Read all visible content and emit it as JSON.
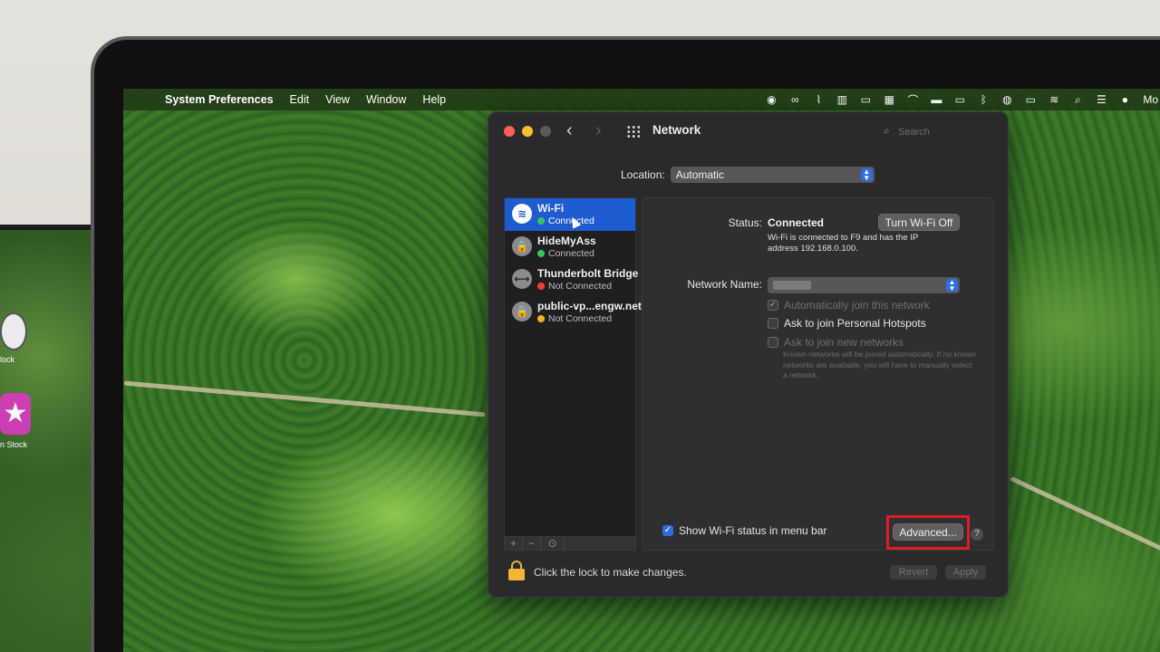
{
  "menubar": {
    "app_name": "System Preferences",
    "menus": [
      "Edit",
      "View",
      "Window",
      "Help"
    ],
    "clock_partial": "Mo"
  },
  "desktop": {
    "side_labels": [
      "lock",
      "n Stock"
    ]
  },
  "window": {
    "title": "Network",
    "search_placeholder": "Search",
    "location_label": "Location:",
    "location_value": "Automatic",
    "services": [
      {
        "name": "Wi-Fi",
        "status": "Connected",
        "dot": "#34c759",
        "icon": "wifi-icon"
      },
      {
        "name": "HideMyAss",
        "status": "Connected",
        "dot": "#34c759",
        "icon": "lock-icon"
      },
      {
        "name": "Thunderbolt Bridge",
        "status": "Not Connected",
        "dot": "#ff3b30",
        "icon": "bridge-icon"
      },
      {
        "name": "public-vp...engw.net",
        "status": "Not Connected",
        "dot": "#ffb020",
        "icon": "lock-icon"
      }
    ],
    "detail": {
      "status_label": "Status:",
      "status_value": "Connected",
      "toggle_button": "Turn Wi-Fi Off",
      "status_description": "Wi-Fi is connected to F9  and has the IP address 192.168.0.100.",
      "network_name_label": "Network Name:",
      "auto_join": "Automatically join this network",
      "ask_hotspots": "Ask to join Personal Hotspots",
      "ask_new": "Ask to join new networks",
      "hint": "Known networks will be joined automatically. If no known networks are available, you will have to manually select a network.",
      "show_status": "Show Wi-Fi status in menu bar",
      "advanced_button": "Advanced...",
      "help": "?"
    },
    "footer": {
      "lock_text": "Click the lock to make changes.",
      "revert": "Revert",
      "apply": "Apply"
    }
  },
  "colors": {
    "selection": "#1d5bd0",
    "highlight_box": "#e01b22"
  }
}
